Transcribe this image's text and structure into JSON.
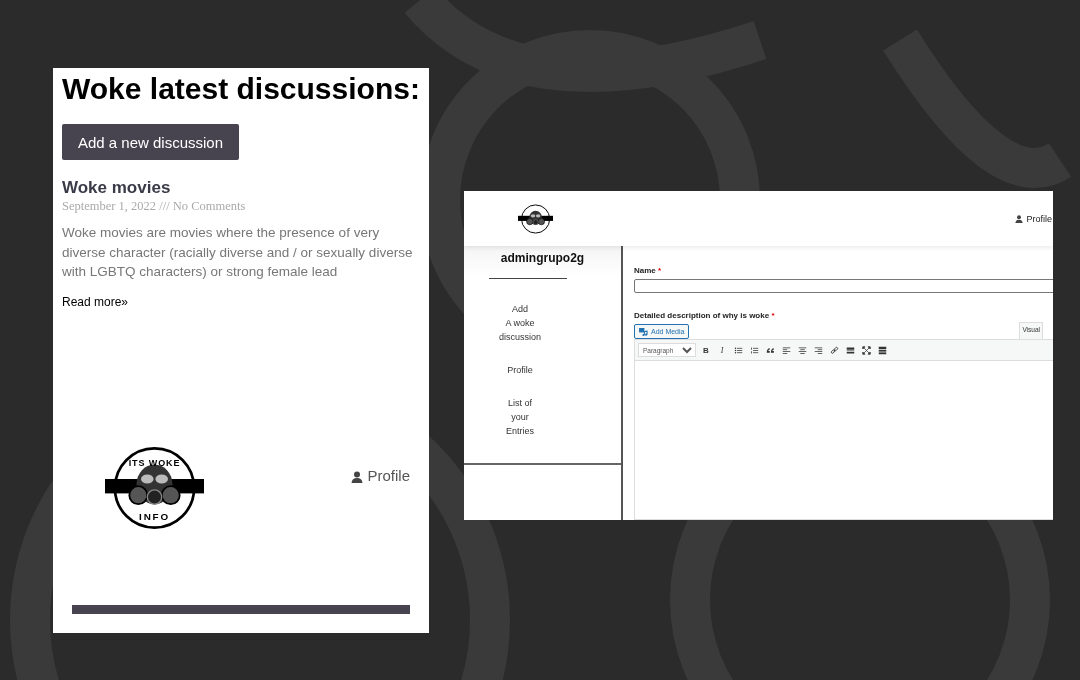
{
  "discussions_page": {
    "heading": "Woke latest discussions:",
    "add_button": "Add a new discussion",
    "post": {
      "title": "Woke movies",
      "meta": "September 1, 2022 /// No Comments",
      "excerpt": "Woke movies are movies where the presence of very diverse character (racially diverse and / or sexually diverse with LGBTQ characters) or strong female lead",
      "read_more": "Read more»"
    },
    "logo": {
      "top_text": "ITS WOKE",
      "bottom_text": "INFO"
    },
    "profile_link": "Profile"
  },
  "admin_page": {
    "profile_link": "Profile",
    "username": "admingrupo2g",
    "sidebar": {
      "items": [
        {
          "label": "Add\nA woke\ndiscussion"
        },
        {
          "label": "Profile"
        },
        {
          "label": "List of\nyour\nEntries"
        }
      ]
    },
    "form": {
      "fields": [
        {
          "label": "Name",
          "required_mark": "*",
          "kind": "input"
        },
        {
          "label": "Detailed description of why is woke",
          "required_mark": "*",
          "kind": "editor"
        }
      ],
      "add_media": "Add Media",
      "editor_tab": "Visual",
      "format_select": "Paragraph",
      "toolbar": [
        {
          "kind": "text",
          "label": "B"
        },
        {
          "kind": "italic",
          "label": "I"
        },
        {
          "kind": "bullets"
        },
        {
          "kind": "numbers"
        },
        {
          "kind": "quote"
        },
        {
          "kind": "align-left"
        },
        {
          "kind": "align-center"
        },
        {
          "kind": "align-right"
        },
        {
          "kind": "link"
        },
        {
          "kind": "more"
        },
        {
          "kind": "fullscreen"
        },
        {
          "kind": "kitchen-sink"
        }
      ]
    }
  }
}
